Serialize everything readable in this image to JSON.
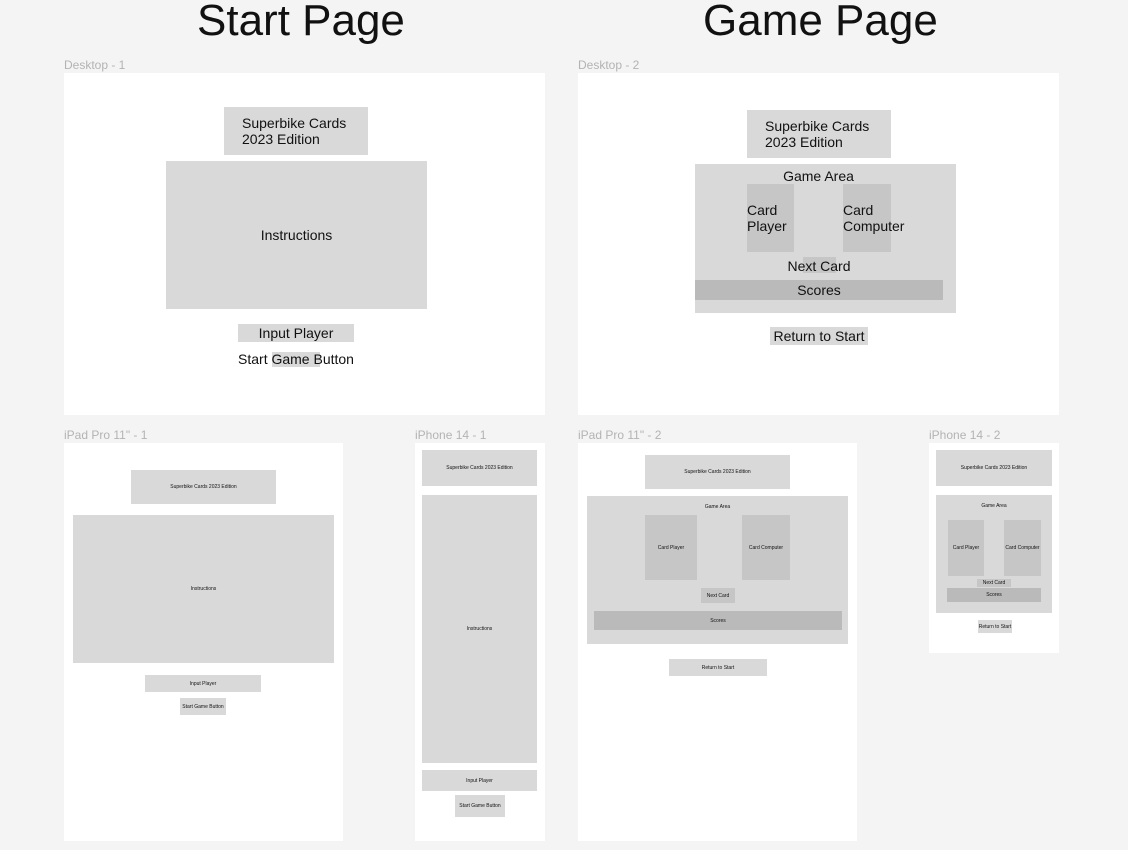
{
  "sections": {
    "start_title": "Start Page",
    "game_title": "Game Page"
  },
  "frames": {
    "desktop1": "Desktop - 1",
    "desktop2": "Desktop - 2",
    "ipad1": "iPad Pro 11\" - 1",
    "iphone1": "iPhone 14 - 1",
    "ipad2": "iPad Pro 11\" - 2",
    "iphone2": "iPhone 14 - 2"
  },
  "start_page": {
    "title_two_line": "Superbike Cards\n2023 Edition",
    "title_one_line": "Superbike Cards 2023 Edition",
    "instructions": "Instructions",
    "input_player": "Input Player",
    "start_button": "Start Game Button"
  },
  "game_page": {
    "title_two_line": "Superbike Cards\n2023 Edition",
    "title_one_line": "Superbike Cards 2023 Edition",
    "game_area": "Game Area",
    "card_player_two_line": "Card\nPlayer",
    "card_computer_two_line": "Card\nComputer",
    "card_player": "Card Player",
    "card_computer": "Card Computer",
    "next_card": "Next Card",
    "scores": "Scores",
    "return_button": "Return to Start"
  },
  "colors": {
    "canvas": "#f4f4f4",
    "frame": "#ffffff",
    "placeholder": "#d9d9d9",
    "placeholder_dark": "#bababa"
  }
}
